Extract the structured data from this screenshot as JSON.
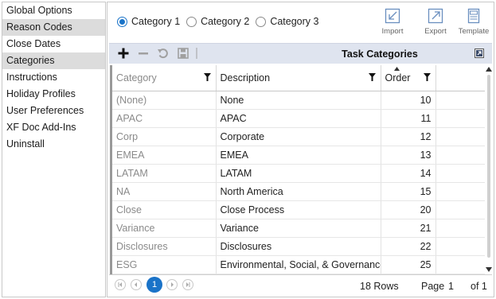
{
  "sidebar": {
    "items": [
      {
        "label": "Global Options",
        "selected": false
      },
      {
        "label": "Reason Codes",
        "selected": true
      },
      {
        "label": "Close Dates",
        "selected": false
      },
      {
        "label": "Categories",
        "selected": true
      },
      {
        "label": "Instructions",
        "selected": false
      },
      {
        "label": "Holiday Profiles",
        "selected": false
      },
      {
        "label": "User Preferences",
        "selected": false
      },
      {
        "label": "XF Doc Add-Ins",
        "selected": false
      },
      {
        "label": "Uninstall",
        "selected": false
      }
    ]
  },
  "radios": [
    {
      "label": "Category 1",
      "checked": true
    },
    {
      "label": "Category 2",
      "checked": false
    },
    {
      "label": "Category 3",
      "checked": false
    }
  ],
  "tools": {
    "import": "Import",
    "export": "Export",
    "template": "Template"
  },
  "grid": {
    "title": "Task Categories",
    "columns": [
      "Category",
      "Description",
      "Order"
    ],
    "rows": [
      {
        "category": "(None)",
        "description": "None",
        "order": "10"
      },
      {
        "category": "APAC",
        "description": "APAC",
        "order": "11"
      },
      {
        "category": "Corp",
        "description": "Corporate",
        "order": "12"
      },
      {
        "category": "EMEA",
        "description": "EMEA",
        "order": "13"
      },
      {
        "category": "LATAM",
        "description": "LATAM",
        "order": "14"
      },
      {
        "category": "NA",
        "description": "North America",
        "order": "15"
      },
      {
        "category": "Close",
        "description": "Close Process",
        "order": "20"
      },
      {
        "category": "Variance",
        "description": "Variance",
        "order": "21"
      },
      {
        "category": "Disclosures",
        "description": "Disclosures",
        "order": "22"
      },
      {
        "category": "ESG",
        "description": "Environmental, Social, & Governance",
        "order": "25"
      }
    ]
  },
  "footer": {
    "current_page_button": "1",
    "rows_text": "18 Rows",
    "page_label": "Page",
    "page_value": "1",
    "of_text": "of 1"
  },
  "colors": {
    "accent": "#1a73c8",
    "header_band": "#dfe4ef",
    "selected_sidebar": "#dcdcdc"
  }
}
